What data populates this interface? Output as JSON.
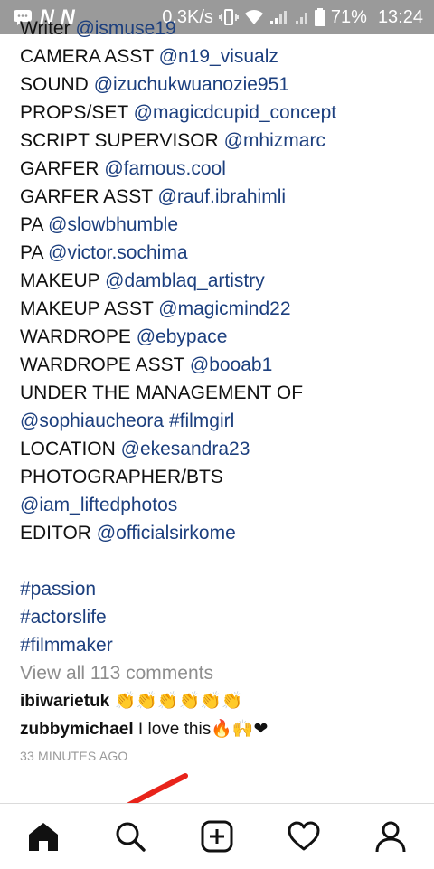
{
  "status_bar": {
    "carrier_badge_1": "N",
    "carrier_badge_2": "N",
    "speed": "0.3K/s",
    "battery": "71%",
    "time": "13:24"
  },
  "caption": {
    "lines": [
      [
        {
          "t": "Writer ",
          "tag": false
        },
        {
          "t": "@ismuse19",
          "tag": true
        }
      ],
      [
        {
          "t": "CAMERA ASST ",
          "tag": false
        },
        {
          "t": "@n19_visualz",
          "tag": true
        }
      ],
      [
        {
          "t": "SOUND ",
          "tag": false
        },
        {
          "t": "@izuchukwuanozie951",
          "tag": true
        }
      ],
      [
        {
          "t": "PROPS/SET ",
          "tag": false
        },
        {
          "t": "@magicdcupid_concept",
          "tag": true
        }
      ],
      [
        {
          "t": "SCRIPT SUPERVISOR ",
          "tag": false
        },
        {
          "t": "@mhizmarc",
          "tag": true
        }
      ],
      [
        {
          "t": "GARFER ",
          "tag": false
        },
        {
          "t": "@famous.cool",
          "tag": true
        }
      ],
      [
        {
          "t": "GARFER ASST ",
          "tag": false
        },
        {
          "t": "@rauf.ibrahimli",
          "tag": true
        }
      ],
      [
        {
          "t": "PA ",
          "tag": false
        },
        {
          "t": "@slowbhumble",
          "tag": true
        }
      ],
      [
        {
          "t": "PA ",
          "tag": false
        },
        {
          "t": "@victor.sochima",
          "tag": true
        }
      ],
      [
        {
          "t": "MAKEUP ",
          "tag": false
        },
        {
          "t": "@damblaq_artistry",
          "tag": true
        }
      ],
      [
        {
          "t": "MAKEUP ASST ",
          "tag": false
        },
        {
          "t": "@magicmind22",
          "tag": true
        }
      ],
      [
        {
          "t": "WARDROPE ",
          "tag": false
        },
        {
          "t": "@ebypace",
          "tag": true
        }
      ],
      [
        {
          "t": "WARDROPE ASST ",
          "tag": false
        },
        {
          "t": "@booab1",
          "tag": true
        }
      ],
      [
        {
          "t": "UNDER THE  MANAGEMENT OF",
          "tag": false
        }
      ],
      [
        {
          "t": "@sophiaucheora",
          "tag": true
        },
        {
          "t": " ",
          "tag": false
        },
        {
          "t": "#filmgirl",
          "tag": true
        }
      ],
      [
        {
          "t": "LOCATION ",
          "tag": false
        },
        {
          "t": "@ekesandra23",
          "tag": true
        }
      ],
      [
        {
          "t": "PHOTOGRAPHER/BTS",
          "tag": false
        }
      ],
      [
        {
          "t": "@iam_liftedphotos",
          "tag": true
        }
      ],
      [
        {
          "t": "EDITOR ",
          "tag": false
        },
        {
          "t": "@officialsirkome",
          "tag": true
        }
      ],
      [],
      [
        {
          "t": "#passion",
          "tag": true
        }
      ],
      [
        {
          "t": "#actorslife",
          "tag": true
        }
      ],
      [
        {
          "t": "#filmmaker",
          "tag": true
        }
      ]
    ]
  },
  "comments": {
    "view_all": "View all 113 comments",
    "items": [
      {
        "user": "ibiwarietuk",
        "text": "👏👏👏👏👏👏"
      },
      {
        "user": "zubbymichael",
        "text": " I love this🔥🙌❤"
      }
    ],
    "timestamp": "33 MINUTES AGO"
  },
  "bottom_nav": {
    "items": [
      {
        "name": "home-icon"
      },
      {
        "name": "search-icon"
      },
      {
        "name": "add-post-icon"
      },
      {
        "name": "heart-icon"
      },
      {
        "name": "profile-icon"
      }
    ]
  },
  "colors": {
    "link": "#1c3f7e",
    "muted": "#8e8e8e",
    "status_bar": "#9a9a9a",
    "annotation": "#e8231a"
  }
}
